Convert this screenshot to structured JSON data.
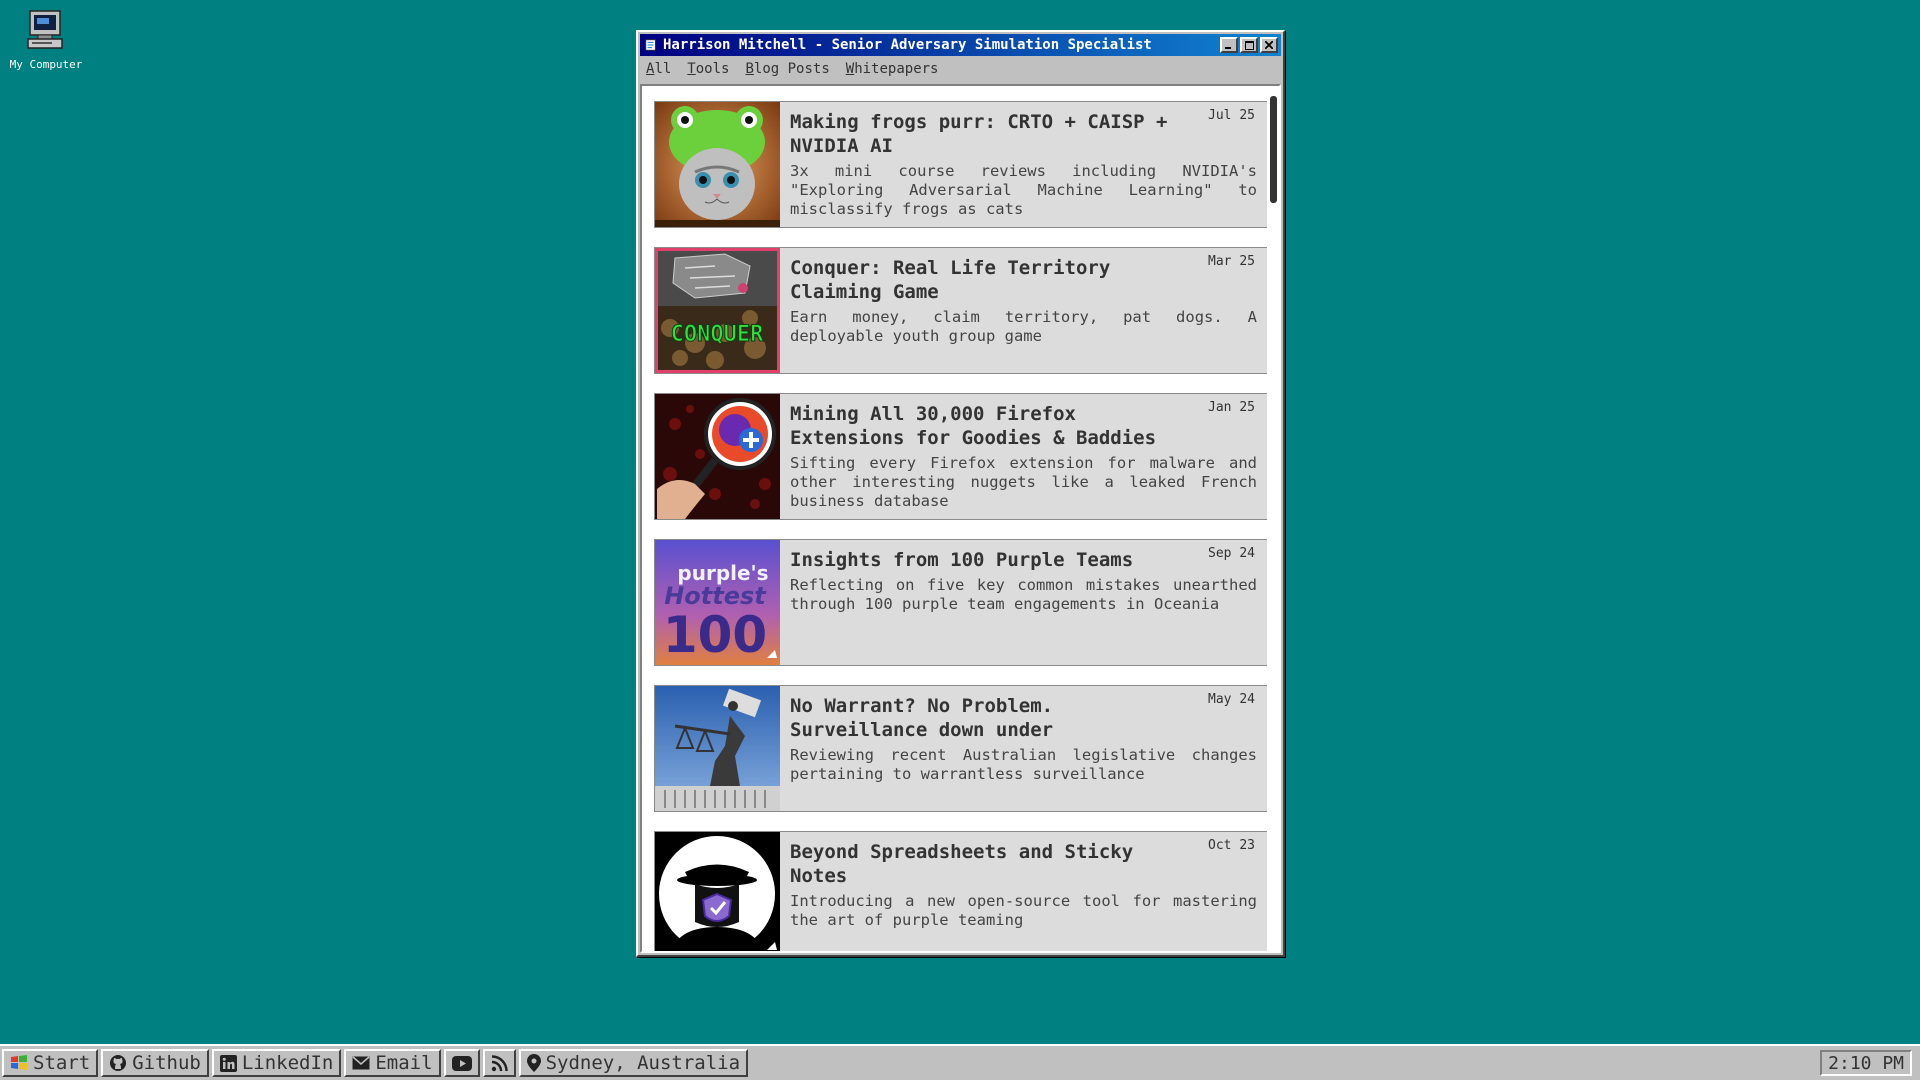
{
  "desktop": {
    "icons": [
      {
        "label": "My Computer",
        "icon": "computer-icon"
      }
    ]
  },
  "window": {
    "title": "Harrison Mitchell - Senior Adversary Simulation Specialist",
    "controls": {
      "minimize": "_",
      "maximize": "□",
      "close": "×"
    }
  },
  "menu": [
    {
      "first": "A",
      "rest": "ll"
    },
    {
      "first": "T",
      "rest": "ools"
    },
    {
      "first": "B",
      "rest": "log Posts"
    },
    {
      "first": "W",
      "rest": "hitepapers"
    }
  ],
  "posts": [
    {
      "title": "Making frogs purr: CRTO + CAISP + NVIDIA AI",
      "date": "Jul 25",
      "description": "3x mini course reviews including NVIDIA's \"Exploring Adversarial Machine Learning\" to misclassify frogs as cats",
      "thumbnail": "cat-in-frog-hat-image"
    },
    {
      "title": "Conquer: Real Life Territory Claiming Game",
      "date": "Mar 25",
      "description": "Earn money, claim territory, pat dogs. A deployable youth group game",
      "thumbnail": "conquer-game-image",
      "thumbnail_text": "CONQUER"
    },
    {
      "title": "Mining All 30,000 Firefox Extensions for Goodies & Baddies",
      "date": "Jan 25",
      "description": "Sifting every Firefox extension for malware and other interesting nuggets like a leaked French business database",
      "thumbnail": "firefox-magnifier-image"
    },
    {
      "title": "Insights from 100 Purple Teams",
      "date": "Sep 24",
      "description": "Reflecting on five key common mistakes unearthed through 100 purple team engagements in Oceania",
      "thumbnail": "purples-hottest-100-image",
      "thumbnail_text": [
        "purple's",
        "Hottest",
        "100"
      ]
    },
    {
      "title": "No Warrant? No Problem. Surveillance down under",
      "date": "May 24",
      "description": "Reviewing recent Australian legislative changes pertaining to warrantless surveillance",
      "thumbnail": "surveillance-statue-image"
    },
    {
      "title": "Beyond Spreadsheets and Sticky Notes",
      "date": "Oct 23",
      "description": "Introducing a new open-source tool for mastering the art of purple teaming",
      "thumbnail": "spy-shield-image"
    }
  ],
  "taskbar": {
    "items": [
      {
        "label": "Start",
        "icon": "windows-logo-icon"
      },
      {
        "label": "Github",
        "icon": "github-icon"
      },
      {
        "label": "LinkedIn",
        "icon": "linkedin-icon"
      },
      {
        "label": "Email",
        "icon": "envelope-icon"
      },
      {
        "label": "",
        "icon": "youtube-icon"
      },
      {
        "label": "",
        "icon": "rss-icon"
      },
      {
        "label": "Sydney, Australia",
        "icon": "location-pin-icon"
      }
    ],
    "clock": "2:10 PM"
  },
  "colors": {
    "desktop": "#008080",
    "titlebar": "#000080",
    "card": "#dcdcdc"
  }
}
